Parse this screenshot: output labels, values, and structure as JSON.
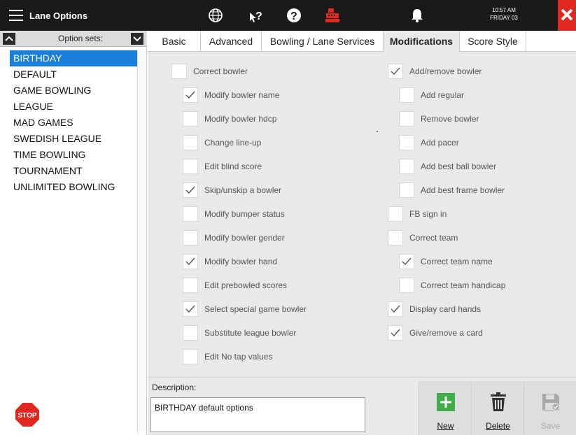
{
  "app": {
    "title": "Lane Options",
    "clock_time": "10:57 AM",
    "clock_date": "FRIDAY 03",
    "colors": {
      "accent": "#1a7fd8",
      "close": "#e0281e",
      "add_green": "#3fae49"
    }
  },
  "option_sets": {
    "label": "Option sets:",
    "items": [
      "BIRTHDAY",
      "DEFAULT",
      "GAME BOWLING",
      "LEAGUE",
      "MAD GAMES",
      "SWEDISH LEAGUE",
      "TIME BOWLING",
      "TOURNAMENT",
      "UNLIMITED BOWLING"
    ],
    "selected": "BIRTHDAY"
  },
  "stop_label": "STOP",
  "tabs": [
    "Basic",
    "Advanced",
    "Bowling / Lane Services",
    "Modifications",
    "Score Style"
  ],
  "active_tab": "Modifications",
  "options_left": [
    {
      "label": "Correct bowler",
      "checked": false,
      "level": 0
    },
    {
      "label": "Modify bowler name",
      "checked": true,
      "level": 1
    },
    {
      "label": "Modify bowler hdcp",
      "checked": false,
      "level": 1
    },
    {
      "label": "Change line-up",
      "checked": false,
      "level": 1
    },
    {
      "label": "Edit blind score",
      "checked": false,
      "level": 1
    },
    {
      "label": "Skip/unskip a bowler",
      "checked": true,
      "level": 1
    },
    {
      "label": "Modify bumper status",
      "checked": false,
      "level": 1
    },
    {
      "label": "Modify bowler gender",
      "checked": false,
      "level": 1
    },
    {
      "label": "Modify bowler hand",
      "checked": true,
      "level": 1
    },
    {
      "label": "Edit prebowled scores",
      "checked": false,
      "level": 1
    },
    {
      "label": "Select special game bowler",
      "checked": true,
      "level": 1
    },
    {
      "label": "Substitute league bowler",
      "checked": false,
      "level": 1
    },
    {
      "label": "Edit No tap values",
      "checked": false,
      "level": 1
    }
  ],
  "options_right": [
    {
      "label": "Add/remove bowler",
      "checked": true,
      "level": 0
    },
    {
      "label": "Add regular",
      "checked": false,
      "level": 1
    },
    {
      "label": "Remove bowler",
      "checked": false,
      "level": 1
    },
    {
      "label": "Add pacer",
      "checked": false,
      "level": 1
    },
    {
      "label": "Add best ball bowler",
      "checked": false,
      "level": 1
    },
    {
      "label": "Add best frame bowler",
      "checked": false,
      "level": 1
    },
    {
      "label": "FB sign in",
      "checked": false,
      "level": 0
    },
    {
      "label": "Correct team",
      "checked": false,
      "level": 0
    },
    {
      "label": "Correct team name",
      "checked": true,
      "level": 1
    },
    {
      "label": "Correct team handicap",
      "checked": false,
      "level": 1
    },
    {
      "label": "Display card hands",
      "checked": true,
      "level": 0
    },
    {
      "label": "Give/remove a card",
      "checked": true,
      "level": 0
    }
  ],
  "description": {
    "label": "Description:",
    "value": "BIRTHDAY default options"
  },
  "actions": {
    "new": "New",
    "delete": "Delete",
    "save": "Save"
  }
}
